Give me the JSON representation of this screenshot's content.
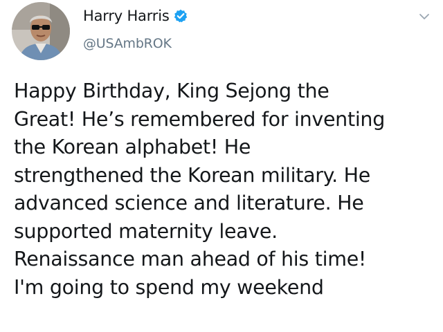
{
  "author": {
    "display_name": "Harry Harris",
    "handle": "@USAmbROK",
    "verified": true
  },
  "icons": {
    "verified": "verified-badge-icon",
    "menu": "chevron-down-icon"
  },
  "colors": {
    "verified_blue": "#1da1f2",
    "text": "#14171a",
    "secondary_text": "#657786"
  },
  "tweet": {
    "lines": [
      "Happy Birthday, King Sejong the",
      "Great! He’s remembered for inventing",
      "the Korean alphabet! He",
      "strengthened the Korean military. He",
      "advanced science and literature. He",
      "supported maternity leave.",
      "Renaissance man ahead of his time!",
      "I'm going to spend my weekend"
    ]
  }
}
